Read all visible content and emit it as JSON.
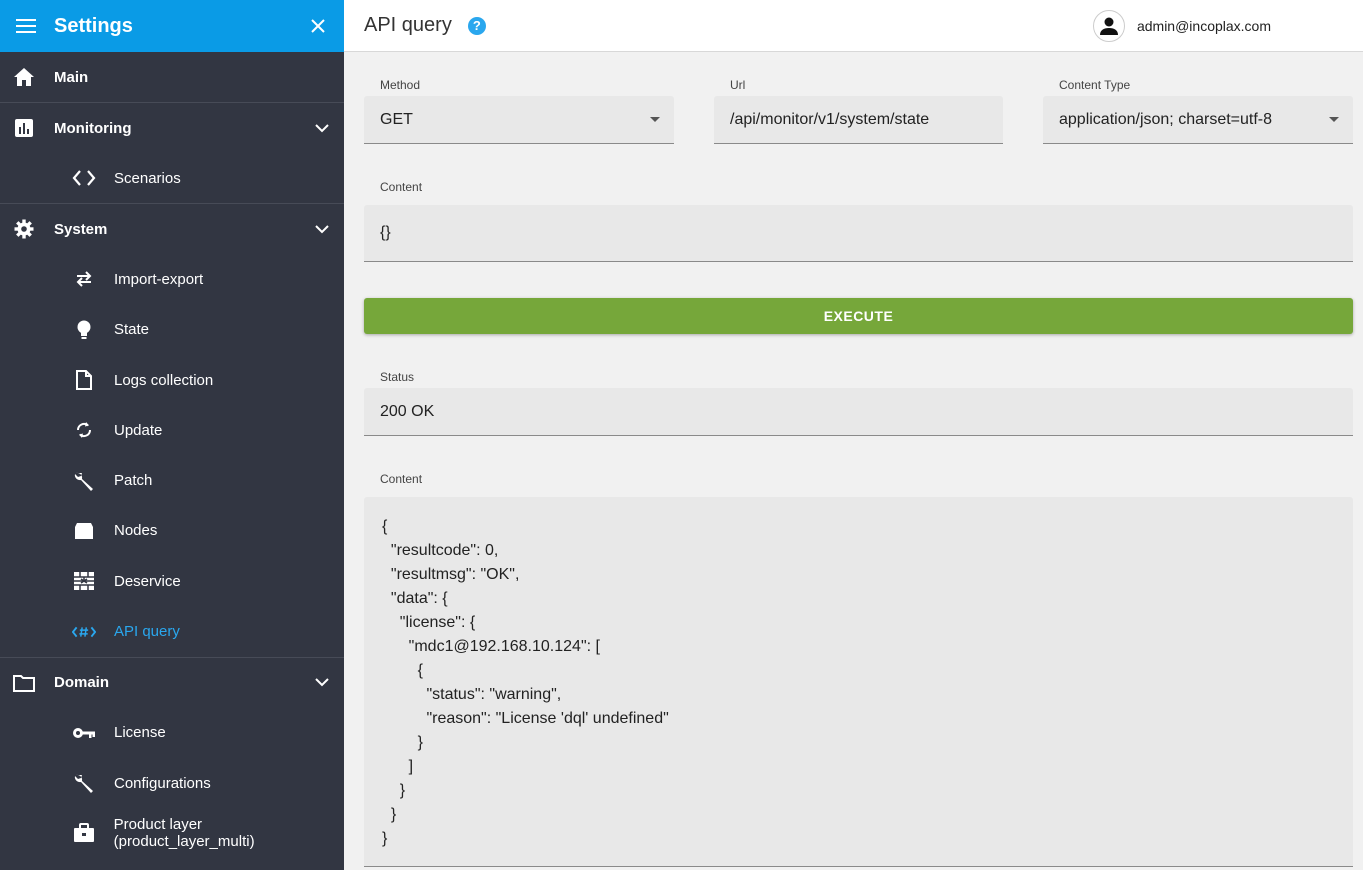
{
  "sidebar": {
    "title": "Settings",
    "main_label": "Main",
    "monitoring": {
      "label": "Monitoring",
      "items": [
        "Scenarios"
      ]
    },
    "system": {
      "label": "System",
      "items": [
        "Import-export",
        "State",
        "Logs collection",
        "Update",
        "Patch",
        "Nodes",
        "Deservice",
        "API query"
      ]
    },
    "domain": {
      "label": "Domain",
      "items": [
        "License",
        "Configurations",
        "Product layer (product_layer_multi)"
      ]
    }
  },
  "header": {
    "title": "API query",
    "help_icon": "?",
    "user": "admin@incoplax.com"
  },
  "form": {
    "method_label": "Method",
    "method_value": "GET",
    "url_label": "Url",
    "url_value": "/api/monitor/v1/system/state",
    "content_type_label": "Content Type",
    "content_type_value": "application/json; charset=utf-8",
    "content_label": "Content",
    "content_value": "{}",
    "execute_label": "EXECUTE",
    "status_label": "Status",
    "status_value": "200 OK",
    "response_label": "Content",
    "response_value": "{\n  \"resultcode\": 0,\n  \"resultmsg\": \"OK\",\n  \"data\": {\n    \"license\": {\n      \"mdc1@192.168.10.124\": [\n        {\n          \"status\": \"warning\",\n          \"reason\": \"License 'dql' undefined\"\n        }\n      ]\n    }\n  }\n}"
  },
  "colors": {
    "sidebar_bg": "#323642",
    "header_blue": "#0a9be6",
    "active_item": "#2aa7ee",
    "execute_green": "#76a73a"
  }
}
